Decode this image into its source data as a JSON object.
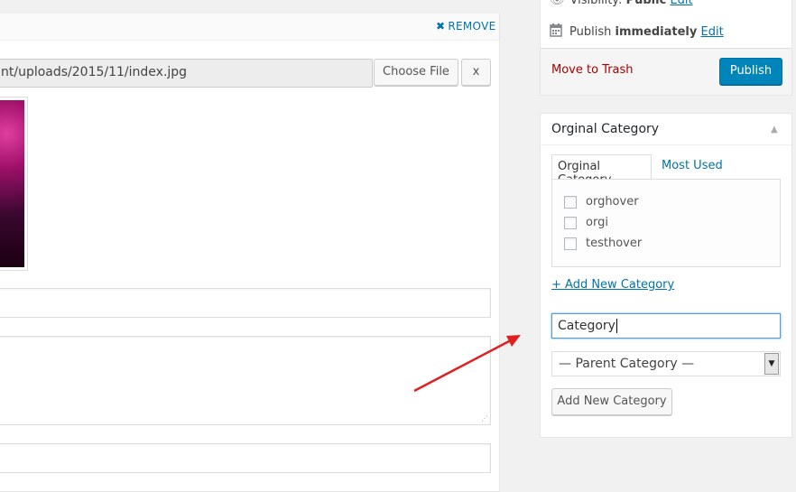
{
  "main": {
    "remove_label": "REMOVE",
    "file_path": "nt/uploads/2015/11/index.jpg",
    "choose_file_label": "Choose File",
    "clear_label": "x"
  },
  "publish": {
    "visibility_label": "Visibility:",
    "visibility_value": "Public",
    "visibility_edit": "Edit",
    "publish_label": "Publish",
    "publish_value": "immediately",
    "publish_edit": "Edit",
    "trash_label": "Move to Trash",
    "publish_button": "Publish"
  },
  "category_box": {
    "title": "Orginal Category",
    "tabs": [
      {
        "label": "Orginal Category"
      },
      {
        "label": "Most Used"
      }
    ],
    "items": [
      {
        "label": "orghover",
        "checked": false
      },
      {
        "label": "orgi",
        "checked": false
      },
      {
        "label": "testhover",
        "checked": false
      }
    ],
    "add_new_link": "+ Add New Category",
    "new_category_value": "Category",
    "parent_select_value": "— Parent Category —",
    "add_button": "Add New Category"
  },
  "colors": {
    "accent": "#0073aa",
    "publish_button": "#0085ba",
    "trash": "#aa0000",
    "annotation_arrow": "#e02020"
  }
}
